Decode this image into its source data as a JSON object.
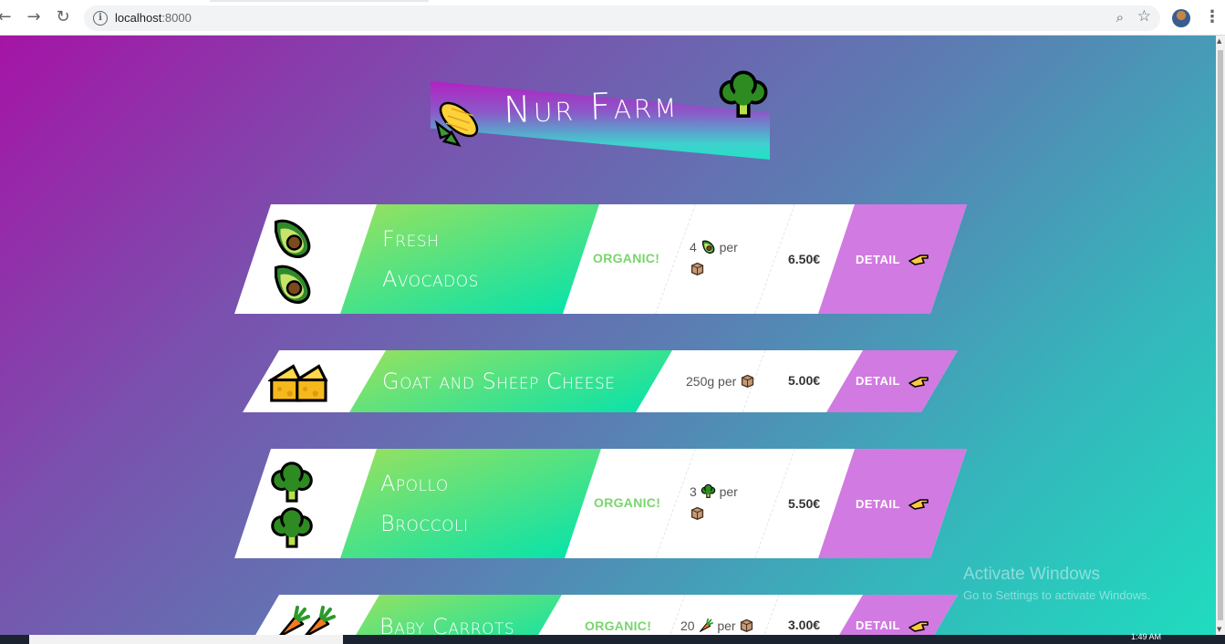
{
  "browser": {
    "url_host": "localhost",
    "url_port": ":8000",
    "back_icon": "arrow-left-icon",
    "forward_icon": "arrow-right-icon",
    "reload_icon": "reload-icon"
  },
  "header": {
    "title": "Nur Farm",
    "left_emoji": "corn",
    "right_emoji": "broccoli"
  },
  "products": [
    {
      "name_line1": "Fresh",
      "name_line2": "Avocados",
      "organic": "ORGANIC!",
      "qty_prefix": "4",
      "qty_suffix": "per",
      "price": "6.50€",
      "detail": "DETAIL",
      "emoji": "avocado"
    },
    {
      "name_line1": "Goat and Sheep Cheese",
      "organic": "",
      "qty_prefix": "250g per",
      "price": "5.00€",
      "detail": "DETAIL",
      "emoji": "cheese"
    },
    {
      "name_line1": "Apollo",
      "name_line2": "Broccoli",
      "organic": "ORGANIC!",
      "qty_prefix": "3",
      "qty_suffix": "per",
      "price": "5.50€",
      "detail": "DETAIL",
      "emoji": "broccoli"
    },
    {
      "name_line1": "Baby Carrots",
      "organic": "ORGANIC!",
      "qty_prefix": "20",
      "qty_suffix": "per",
      "price": "3.00€",
      "detail": "DETAIL",
      "emoji": "carrot"
    }
  ],
  "os": {
    "watermark_title": "Activate Windows",
    "watermark_sub": "Go to Settings to activate Windows.",
    "clock": "1:49 AM"
  },
  "colors": {
    "name_gradient_start": "#9be15d",
    "name_gradient_end": "#00e3ae",
    "detail_bg": "#d17ae1",
    "organic_text": "#79d56d"
  }
}
